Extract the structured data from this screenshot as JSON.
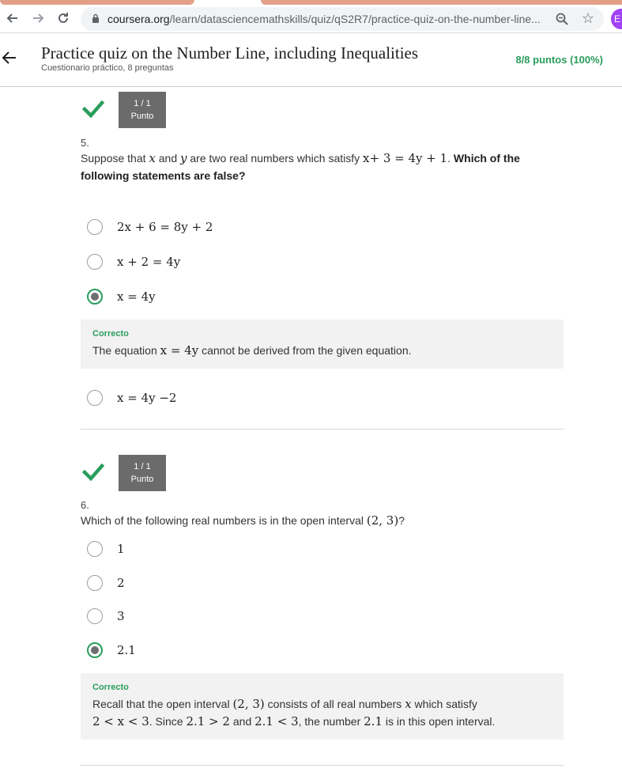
{
  "browser": {
    "url_host": "coursera.org",
    "url_path": "/learn/datasciencemathskills/quiz/qS2R7/practice-quiz-on-the-number-line...",
    "profile_initial": "E"
  },
  "header": {
    "title": "Practice quiz on the Number Line, including Inequalities",
    "subtitle": "Cuestionario práctico, 8 preguntas",
    "score": "8/8 puntos (100%)"
  },
  "questions": [
    {
      "points_score": "1 / 1",
      "points_label": "Punto",
      "number": "5.",
      "text_parts": {
        "t1": "Suppose that ",
        "x": "x",
        "t2": " and ",
        "y": "y",
        "t3": " are two real numbers which satisfy ",
        "eq": "x+ 3 = 4y + 1",
        "t4": ". ",
        "bold": "Which of the following statements are false?"
      },
      "options": [
        {
          "label": "2x + 6 = 8y + 2",
          "selected": false
        },
        {
          "label": "x + 2 = 4y",
          "selected": false
        },
        {
          "label": "x = 4y",
          "selected": true
        },
        {
          "label": "x = 4y −2",
          "selected": false
        }
      ],
      "feedback": {
        "title": "Correcto",
        "t1": "The equation ",
        "eq": "x = 4y",
        "t2": " cannot be derived from the given equation."
      }
    },
    {
      "points_score": "1 / 1",
      "points_label": "Punto",
      "number": "6.",
      "text_parts": {
        "t1": "Which of the following real numbers is in the open interval ",
        "interval": "(2, 3)",
        "t2": "?"
      },
      "options": [
        {
          "label": "1",
          "selected": false
        },
        {
          "label": "2",
          "selected": false
        },
        {
          "label": "3",
          "selected": false
        },
        {
          "label": "2.1",
          "selected": true
        }
      ],
      "feedback": {
        "title": "Correcto",
        "t1": "Recall that the open interval ",
        "interval": "(2, 3)",
        "t2": " consists of all real numbers ",
        "x": "x",
        "t3": " which satisfy",
        "ineq": "2 < x < 3",
        "t4": ". Since ",
        "c1": "2.1 > 2",
        "t5": " and ",
        "c2": "2.1 < 3",
        "t6": ", the number ",
        "n": "2.1",
        "t7": " is in this open interval."
      }
    }
  ],
  "colors": {
    "correct_green": "#2a9d5c",
    "points_box": "#6b6b6b",
    "feedback_bg": "#f2f2f2"
  }
}
